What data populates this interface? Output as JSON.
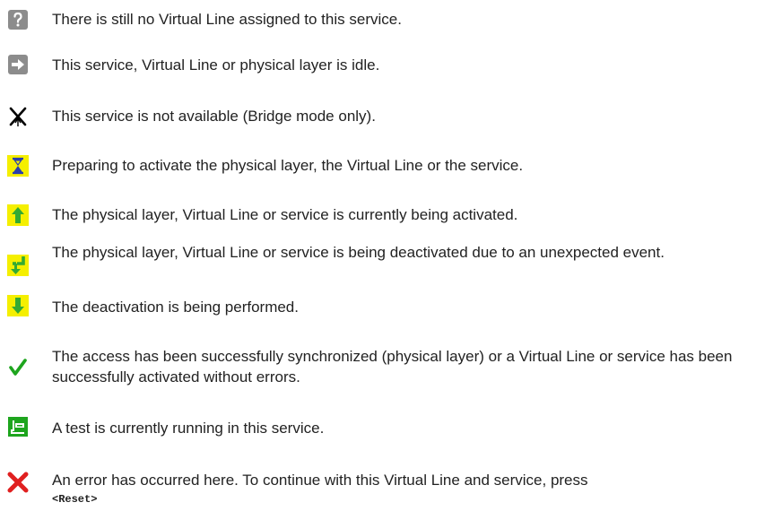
{
  "legend": [
    {
      "icon": "question-icon",
      "text": "There is still no Virtual Line assigned to this service."
    },
    {
      "icon": "arrow-right-icon",
      "text": "This service, Virtual Line or physical layer is idle."
    },
    {
      "icon": "x-not-available-icon",
      "text": "This service is not available (Bridge mode only)."
    },
    {
      "icon": "hourglass-icon",
      "text": "Preparing to activate the physical layer, the Virtual Line or the service."
    },
    {
      "icon": "arrow-up-icon",
      "text": "The physical layer, Virtual Line or service is currently being activated."
    },
    {
      "icon": "arrow-return-icon",
      "text": "The physical layer, Virtual Line or service is being deactivated due to an unexpected event."
    },
    {
      "icon": "arrow-down-icon",
      "text": "The deactivation is being performed."
    },
    {
      "icon": "checkmark-icon",
      "text": "The access has been successfully synchronized (physical layer) or a Virtual Line or service has been successfully activated without errors."
    },
    {
      "icon": "test-icon",
      "text": "A test is currently running in this service."
    },
    {
      "icon": "error-x-icon",
      "text": "An error has occurred here. To continue with this Virtual Line and service, press",
      "code": "<Reset>"
    }
  ],
  "colors": {
    "gray_icon": "#8c8c8c",
    "yellow_icon": "#f5ef00",
    "green_icon": "#1ea51e",
    "red_icon": "#e02020"
  }
}
